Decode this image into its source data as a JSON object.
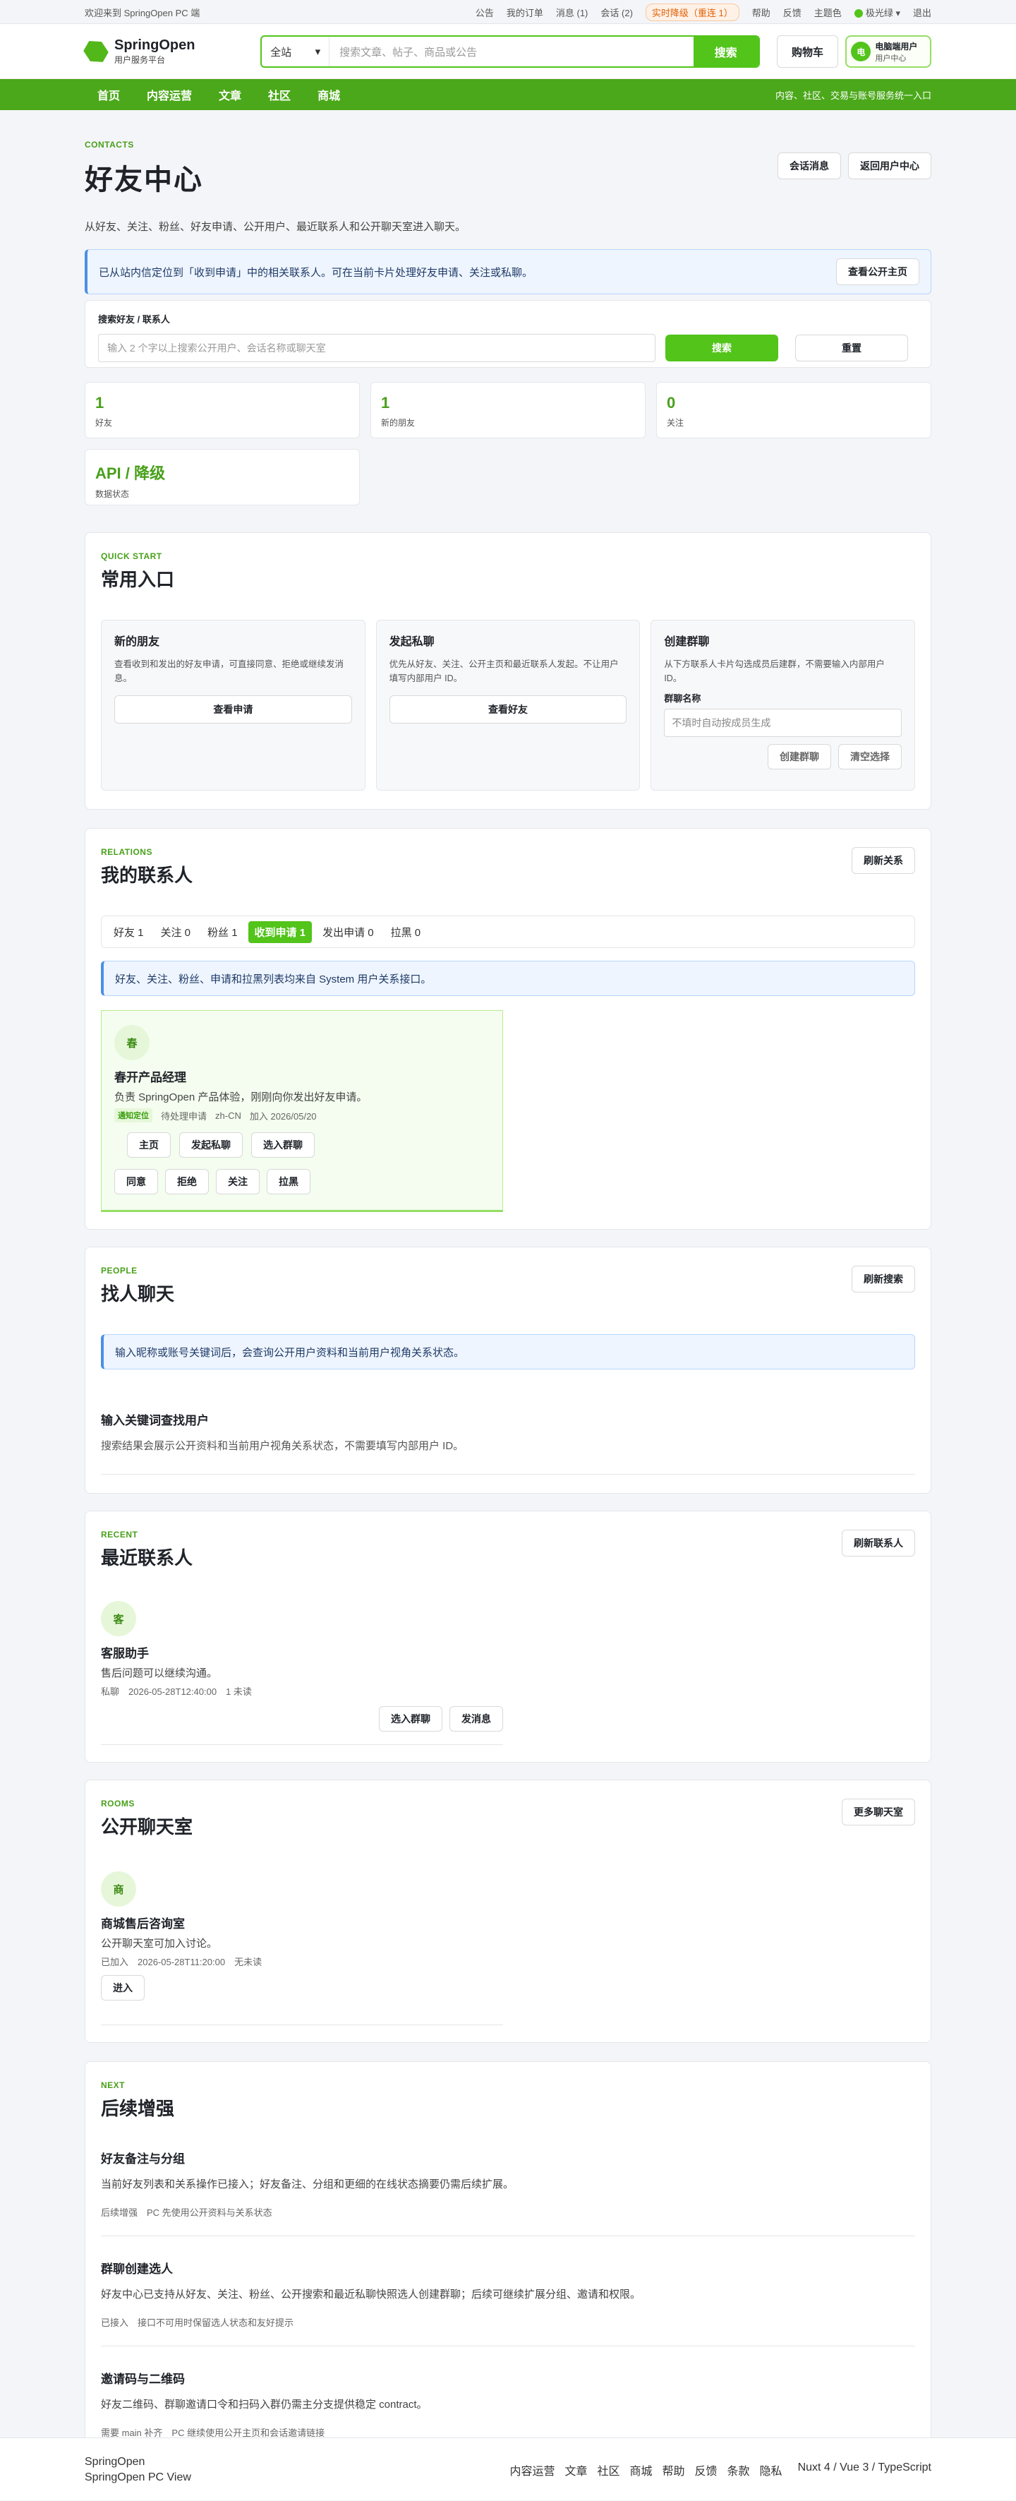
{
  "topbar": {
    "welcome": "欢迎来到 SpringOpen PC 端",
    "links": [
      "公告",
      "我的订单",
      "消息 (1)",
      "会话 (2)"
    ],
    "realtime": "实时降级（重连 1）",
    "links2": [
      "帮助",
      "反馈"
    ],
    "theme": "主题色",
    "theme_name": "极光绿",
    "logout": "退出"
  },
  "header": {
    "logo_title": "SpringOpen",
    "logo_sub": "用户服务平台",
    "scope": "全站",
    "search_placeholder": "搜索文章、帖子、商品或公告",
    "search_btn": "搜索",
    "cart": "购物车",
    "user_avatar": "电",
    "user_name": "电脑端用户",
    "user_sub": "用户中心"
  },
  "nav": {
    "items": [
      "首页",
      "内容运营",
      "文章",
      "社区",
      "商城"
    ],
    "tagline": "内容、社区、交易与账号服务统一入口"
  },
  "page": {
    "eyebrow": "CONTACTS",
    "title": "好友中心",
    "btn_messages": "会话消息",
    "btn_back": "返回用户中心",
    "desc": "从好友、关注、粉丝、好友申请、公开用户、最近联系人和公开聊天室进入聊天。",
    "notice": "已从站内信定位到「收到申请」中的相关联系人。可在当前卡片处理好友申请、关注或私聊。",
    "notice_btn": "查看公开主页",
    "search_label": "搜索好友 / 联系人",
    "search_placeholder": "输入 2 个字以上搜索公开用户、会话名称或聊天室",
    "search_btn": "搜索",
    "reset_btn": "重置"
  },
  "stats": [
    {
      "value": "1",
      "label": "好友"
    },
    {
      "value": "1",
      "label": "新的朋友"
    },
    {
      "value": "0",
      "label": "关注"
    },
    {
      "value": "API / 降级",
      "label": "数据状态"
    }
  ],
  "quick": {
    "eyebrow": "QUICK START",
    "title": "常用入口",
    "boxes": [
      {
        "title": "新的朋友",
        "desc": "查看收到和发出的好友申请，可直接同意、拒绝或继续发消息。",
        "btn": "查看申请"
      },
      {
        "title": "发起私聊",
        "desc": "优先从好友、关注、公开主页和最近联系人发起。不让用户填写内部用户 ID。",
        "btn": "查看好友"
      },
      {
        "title": "创建群聊",
        "desc": "从下方联系人卡片勾选成员后建群，不需要输入内部用户 ID。",
        "field_label": "群聊名称",
        "field_placeholder": "不填时自动按成员生成",
        "btn_create": "创建群聊",
        "btn_clear": "清空选择"
      }
    ]
  },
  "relations": {
    "eyebrow": "RELATIONS",
    "title": "我的联系人",
    "refresh": "刷新关系",
    "tabs": [
      "好友 1",
      "关注 0",
      "粉丝 1",
      "收到申请 1",
      "发出申请 0",
      "拉黑 0"
    ],
    "info": "好友、关注、粉丝、申请和拉黑列表均来自 System 用户关系接口。",
    "contact": {
      "avatar": "春",
      "name": "春开产品经理",
      "desc": "负责 SpringOpen 产品体验，刚刚向你发出好友申请。",
      "tag": "通知定位",
      "meta": [
        "待处理申请",
        "zh-CN",
        "加入 2026/05/20"
      ],
      "actions": [
        "主页",
        "发起私聊",
        "选入群聊"
      ],
      "actions2": [
        "同意",
        "拒绝",
        "关注",
        "拉黑"
      ]
    }
  },
  "people": {
    "eyebrow": "PEOPLE",
    "title": "找人聊天",
    "refresh": "刷新搜索",
    "info": "输入昵称或账号关键词后，会查询公开用户资料和当前用户视角关系状态。",
    "hint_title": "输入关键词查找用户",
    "hint_desc": "搜索结果会展示公开资料和当前用户视角关系状态，不需要填写内部用户 ID。"
  },
  "recent": {
    "eyebrow": "RECENT",
    "title": "最近联系人",
    "refresh": "刷新联系人",
    "avatar": "客",
    "name": "客服助手",
    "desc": "售后问题可以继续沟通。",
    "meta": "私聊　2026-05-28T12:40:00　1 未读",
    "btn_group": "选入群聊",
    "btn_msg": "发消息"
  },
  "rooms": {
    "eyebrow": "ROOMS",
    "title": "公开聊天室",
    "more": "更多聊天室",
    "avatar": "商",
    "name": "商城售后咨询室",
    "desc": "公开聊天室可加入讨论。",
    "meta": "已加入　2026-05-28T11:20:00　无未读",
    "btn": "进入"
  },
  "next": {
    "eyebrow": "NEXT",
    "title": "后续增强",
    "items": [
      {
        "title": "好友备注与分组",
        "desc": "当前好友列表和关系操作已接入；好友备注、分组和更细的在线状态摘要仍需后续扩展。",
        "meta": "后续增强　PC 先使用公开资料与关系状态"
      },
      {
        "title": "群聊创建选人",
        "desc": "好友中心已支持从好友、关注、粉丝、公开搜索和最近私聊快照选人创建群聊；后续可继续扩展分组、邀请和权限。",
        "meta": "已接入　接口不可用时保留选人状态和友好提示"
      },
      {
        "title": "邀请码与二维码",
        "desc": "好友二维码、群聊邀请口令和扫码入群仍需主分支提供稳定 contract。",
        "meta": "需要 main 补齐　PC 继续使用公开主页和会话邀请链接"
      }
    ]
  },
  "footer": {
    "brand": "SpringOpen",
    "sub": "SpringOpen PC View",
    "links": [
      "内容运营",
      "文章",
      "社区",
      "商城",
      "帮助",
      "反馈",
      "条款",
      "隐私"
    ],
    "stack": "Nuxt 4 / Vue 3 / TypeScript"
  }
}
